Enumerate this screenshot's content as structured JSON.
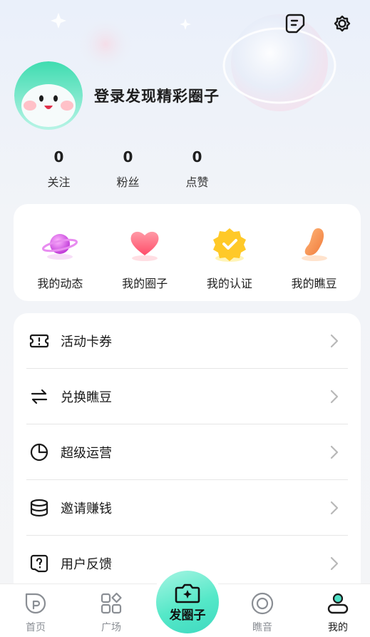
{
  "header": {
    "login_prompt": "登录发现精彩圈子"
  },
  "stats": [
    {
      "value": "0",
      "label": "关注"
    },
    {
      "value": "0",
      "label": "粉丝"
    },
    {
      "value": "0",
      "label": "点赞"
    }
  ],
  "shortcuts": [
    {
      "label": "我的动态",
      "icon": "planet-icon"
    },
    {
      "label": "我的圈子",
      "icon": "heart-icon"
    },
    {
      "label": "我的认证",
      "icon": "verified-badge-icon"
    },
    {
      "label": "我的瞧豆",
      "icon": "bean-icon"
    }
  ],
  "menu": [
    {
      "label": "活动卡券",
      "icon": "ticket-icon"
    },
    {
      "label": "兑换瞧豆",
      "icon": "exchange-icon"
    },
    {
      "label": "超级运营",
      "icon": "pie-chart-icon"
    },
    {
      "label": "邀请赚钱",
      "icon": "coins-stack-icon"
    },
    {
      "label": "用户反馈",
      "icon": "feedback-icon"
    }
  ],
  "tabbar": {
    "home": "首页",
    "square": "广场",
    "post": "发圈子",
    "sound": "瞧音",
    "mine": "我的",
    "active_tab": "mine"
  },
  "colors": {
    "accent_mint": "#55e8c8",
    "active_tab_text": "#1a1a1a",
    "inactive_tab_text": "#8a8e94"
  }
}
